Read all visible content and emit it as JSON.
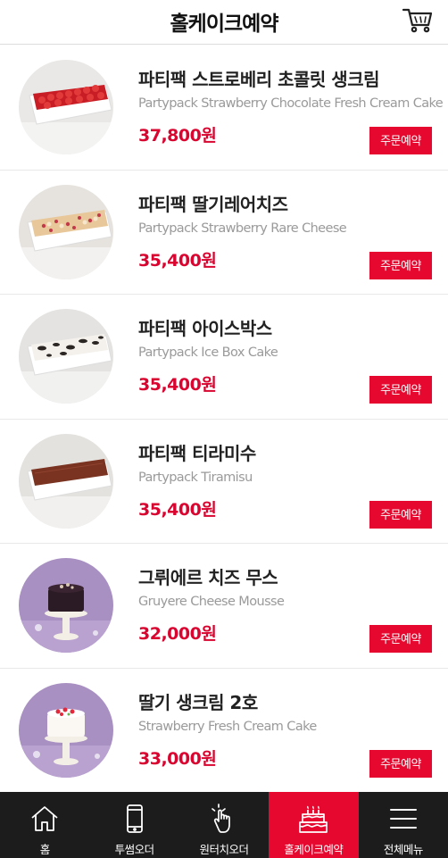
{
  "header": {
    "title": "홀케이크예약",
    "cart_icon": "cart-icon"
  },
  "products": [
    {
      "name": "파티팩 스트로베리 초콜릿 생크림",
      "english": "Partypack Strawberry Chocolate Fresh Cream Cake",
      "price": "37,800원",
      "button": "주문예약",
      "image": "white-dish-strawberry-cake"
    },
    {
      "name": "파티팩 딸기레어치즈",
      "english": "Partypack Strawberry Rare Cheese",
      "price": "35,400원",
      "button": "주문예약",
      "image": "white-dish-crumble-cheese"
    },
    {
      "name": "파티팩 아이스박스",
      "english": "Partypack Ice Box Cake",
      "price": "35,400원",
      "button": "주문예약",
      "image": "white-dish-cookie-cream"
    },
    {
      "name": "파티팩 티라미수",
      "english": "Partypack Tiramisu",
      "price": "35,400원",
      "button": "주문예약",
      "image": "white-dish-tiramisu"
    },
    {
      "name": "그뤼에르 치즈 무스",
      "english": "Gruyere Cheese Mousse",
      "price": "32,000원",
      "button": "주문예약",
      "image": "dark-round-cake-on-stand"
    },
    {
      "name": "딸기 생크림 2호",
      "english": "Strawberry Fresh Cream Cake",
      "price": "33,000원",
      "button": "주문예약",
      "image": "white-round-cake-on-stand"
    }
  ],
  "nav": [
    {
      "label": "홈",
      "icon": "home-icon"
    },
    {
      "label": "투썸오더",
      "icon": "phone-icon"
    },
    {
      "label": "원터치오더",
      "icon": "tap-hand-icon"
    },
    {
      "label": "홀케이크예약",
      "icon": "cake-icon",
      "active": true
    },
    {
      "label": "전체메뉴",
      "icon": "menu-icon"
    }
  ],
  "colors": {
    "accent": "#e6082f",
    "price": "#d9042f",
    "nav_bg": "#1c1c1c"
  }
}
